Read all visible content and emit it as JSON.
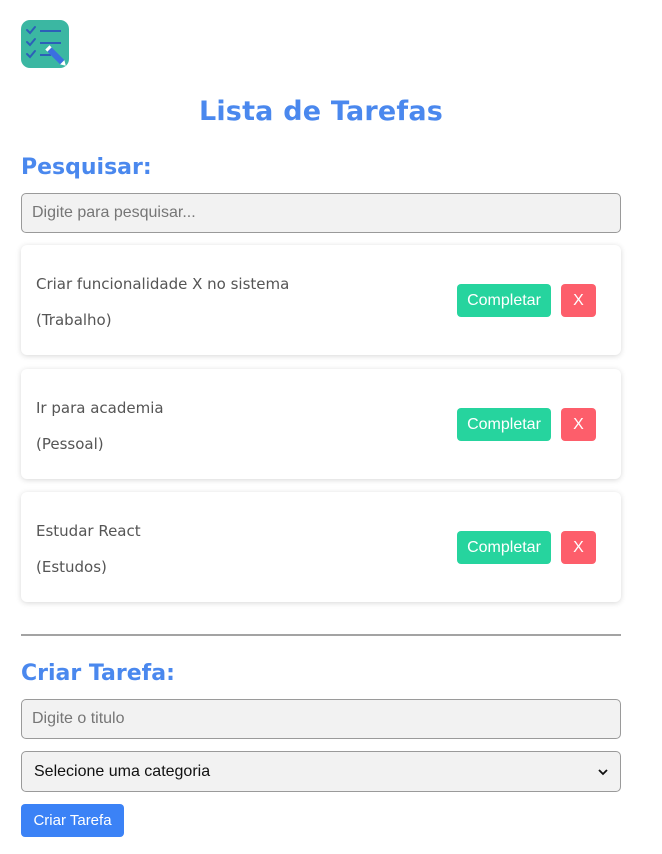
{
  "app": {
    "logo_icon": "task-list-logo-icon",
    "title": "Lista de Tarefas"
  },
  "search": {
    "label": "Pesquisar:",
    "placeholder": "Digite para pesquisar..."
  },
  "todos": [
    {
      "title": "Criar funcionalidade X no sistema",
      "category": "(Trabalho)",
      "complete_label": "Completar",
      "remove_label": "X"
    },
    {
      "title": "Ir para academia",
      "category": "(Pessoal)",
      "complete_label": "Completar",
      "remove_label": "X"
    },
    {
      "title": "Estudar React",
      "category": "(Estudos)",
      "complete_label": "Completar",
      "remove_label": "X"
    }
  ],
  "create": {
    "label": "Criar Tarefa:",
    "title_placeholder": "Digite o titulo",
    "category_selected": "Selecione uma categoria",
    "submit_label": "Criar Tarefa"
  },
  "colors": {
    "heading": "#4a88ee",
    "complete": "#26d49e",
    "remove": "#fd5e6b",
    "primary": "#3b82f6"
  }
}
